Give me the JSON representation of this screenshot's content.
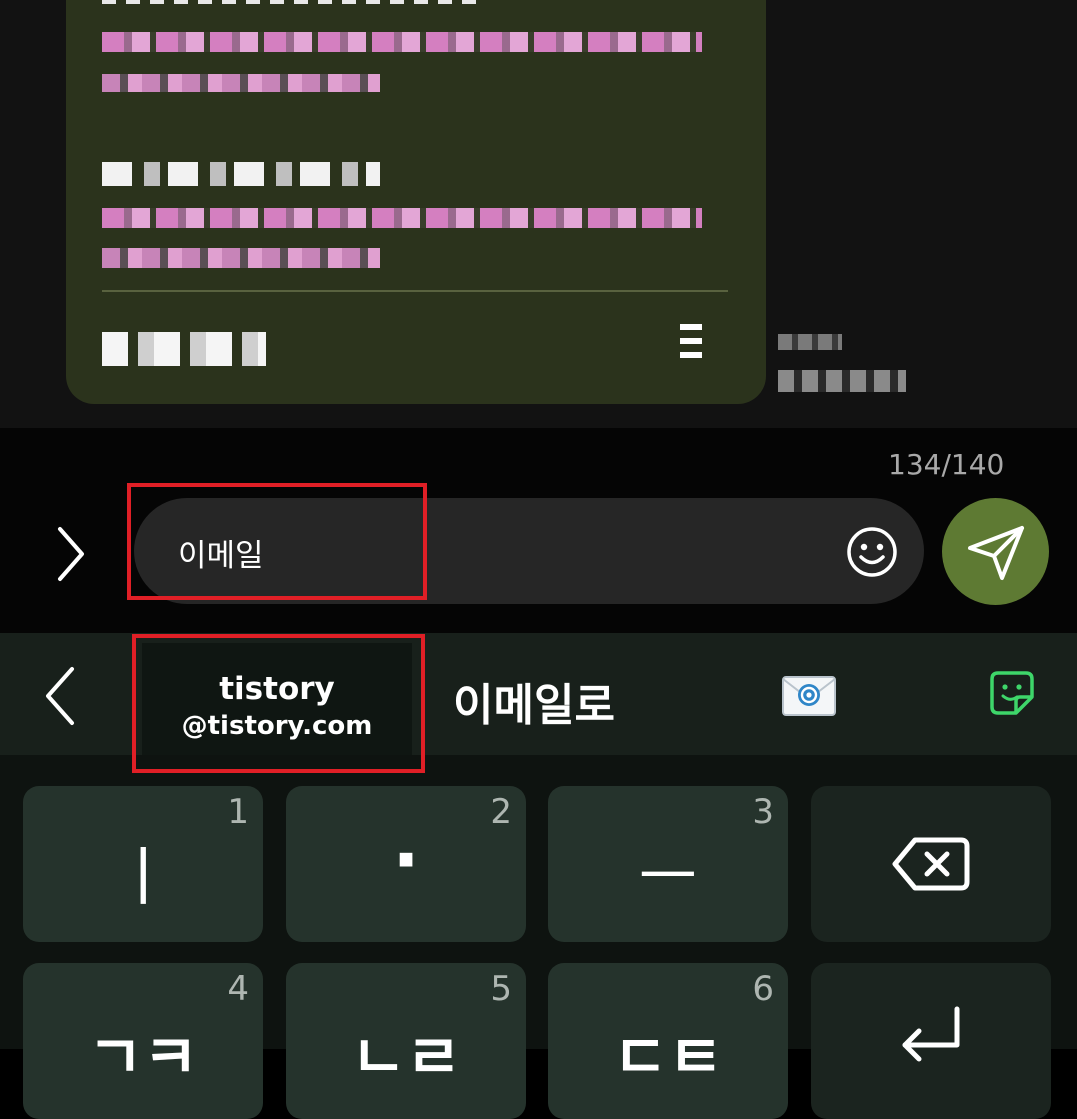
{
  "input": {
    "counter": "134/140",
    "text": "이메일"
  },
  "suggestions": {
    "chip_line1": "tistory",
    "chip_line2": "@tistory.com",
    "word": "이메일로"
  },
  "keyboard": {
    "keys": [
      {
        "num": "1",
        "glyph": "ㅣ"
      },
      {
        "num": "2",
        "glyph": "·"
      },
      {
        "num": "3",
        "glyph": "ㅡ"
      },
      {
        "num": "4",
        "glyph": "ㄱㅋ"
      },
      {
        "num": "5",
        "glyph": "ㄴㄹ"
      },
      {
        "num": "6",
        "glyph": "ㄷㅌ"
      }
    ]
  },
  "colors": {
    "accent_send": "#5e7a33",
    "highlight_box": "#e01f26",
    "bubble": "#2b331c"
  },
  "icons": [
    "chevron-right-icon",
    "smiley-icon",
    "send-icon",
    "chevron-left-icon",
    "email-icon",
    "sticker-icon",
    "backspace-icon",
    "enter-icon"
  ]
}
